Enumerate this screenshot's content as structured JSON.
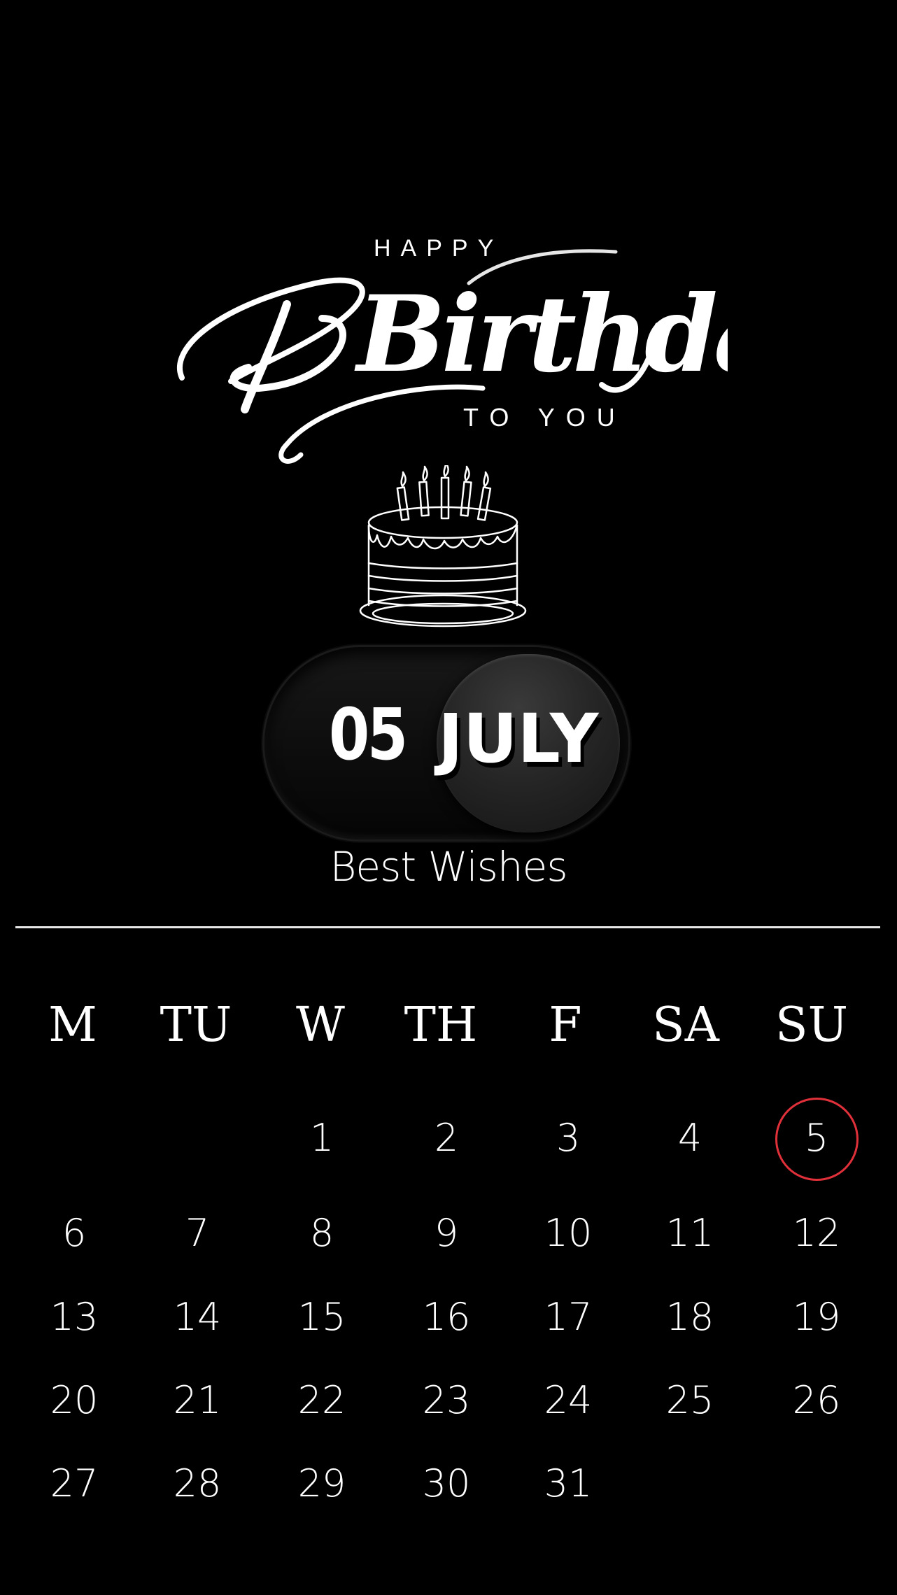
{
  "greeting": {
    "happy": "HAPPY",
    "title": "Birthday",
    "to_you": "TO YOU"
  },
  "date_toggle": {
    "day": "05",
    "month": "JULY"
  },
  "subtitle": "Best Wishes",
  "calendar": {
    "weekdays": [
      "M",
      "TU",
      "W",
      "TH",
      "F",
      "SA",
      "SU"
    ],
    "weeks": [
      [
        "",
        "",
        "1",
        "2",
        "3",
        "4",
        "5"
      ],
      [
        "6",
        "7",
        "8",
        "9",
        "10",
        "11",
        "12"
      ],
      [
        "13",
        "14",
        "15",
        "16",
        "17",
        "18",
        "19"
      ],
      [
        "20",
        "21",
        "22",
        "23",
        "24",
        "25",
        "26"
      ],
      [
        "27",
        "28",
        "29",
        "30",
        "31",
        "",
        ""
      ]
    ],
    "highlighted_date": "5",
    "highlight_color": "#e0303a"
  },
  "colors": {
    "background": "#000000",
    "text": "#ffffff"
  },
  "icons": {
    "cake": "birthday-cake-icon"
  }
}
